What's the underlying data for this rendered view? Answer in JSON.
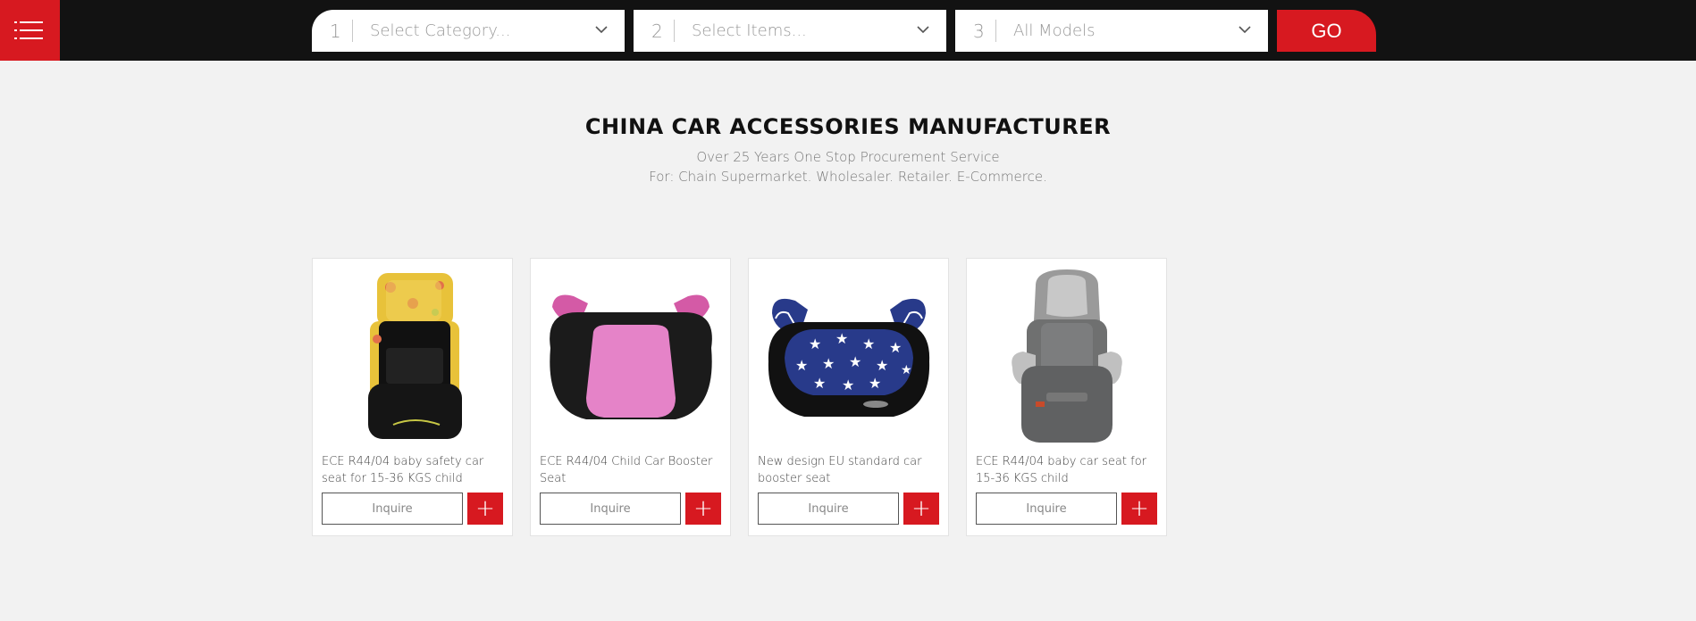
{
  "header": {
    "menu_icon": "hamburger-menu-icon",
    "selectors": [
      {
        "num": "1",
        "label": "Select Category..."
      },
      {
        "num": "2",
        "label": "Select Items..."
      },
      {
        "num": "3",
        "label": "All Models"
      }
    ],
    "go_label": "GO"
  },
  "hero": {
    "title": "CHINA CAR ACCESSORIES MANUFACTURER",
    "subtitle1": "Over 25 Years One Stop Procurement Service",
    "subtitle2": "For: Chain Supermarket. Wholesaler. Retailer. E-Commerce."
  },
  "products": [
    {
      "title": "ECE R44/04 baby safety car seat for 15-36 KGS child",
      "inquire": "Inquire",
      "plus": "+"
    },
    {
      "title": "ECE R44/04 Child Car Booster Seat",
      "inquire": "Inquire",
      "plus": "+"
    },
    {
      "title": "New design EU standard car booster seat",
      "inquire": "Inquire",
      "plus": "+"
    },
    {
      "title": "ECE R44/04 baby car seat for 15-36 KGS child",
      "inquire": "Inquire",
      "plus": "+"
    }
  ],
  "colors": {
    "accent": "#d71920",
    "topbar": "#121212",
    "background": "#f2f2f2"
  }
}
